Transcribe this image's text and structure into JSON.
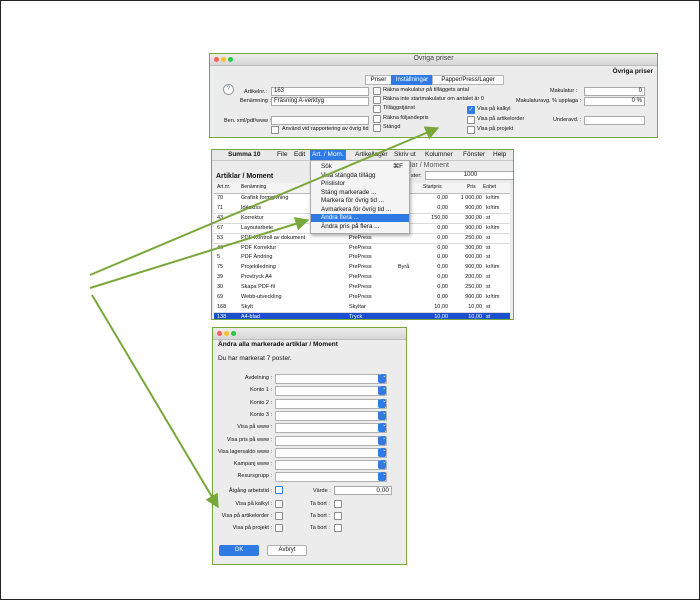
{
  "colors": {
    "accent": "#2f7ae5",
    "arrow": "#79a83a",
    "selected_row": "#1b4fcf"
  },
  "prices_window": {
    "title": "Övriga priser",
    "heading": "Övriga priser",
    "tabs": [
      "Priser",
      "Inställningar",
      "Papper/Press/Lager"
    ],
    "selected_tab": "Inställningar",
    "help_icon": "?",
    "artnr_label": "Artikelnr.:",
    "artnr_value": "163",
    "desc_label": "Benämning :",
    "desc_value": "Fräsning A-verktyg",
    "alt_label": "Ben. xml/pdf/www :",
    "alt_value": "",
    "use_stats_label": "Använd vid rapportering av övrig tid",
    "middle_checks": [
      {
        "label": "Räkna makulatur på tilläggets antal",
        "checked": false
      },
      {
        "label": "Räkna inte startmakulatur om antalet är 0",
        "checked": false
      },
      {
        "label": "Tilläggstjänst",
        "checked": false
      },
      {
        "label": "Räkna följandepris",
        "checked": false
      },
      {
        "label": "Stängd",
        "checked": false
      }
    ],
    "right_checks": [
      {
        "label": "Visa på kalkyl",
        "checked": true
      },
      {
        "label": "Visa på artikelorder",
        "checked": false
      },
      {
        "label": "Visa på projekt",
        "checked": false
      }
    ],
    "makulatur_label": "Makulatur :",
    "makulatur_value": "0",
    "makupp_label": "Makulaturavg. % upplaga :",
    "makupp_value": "0 %",
    "underavd_label": "Underavd. :",
    "underavd_value": ""
  },
  "summa_window": {
    "apple_icon": "",
    "menu": [
      "Summa 10",
      "File",
      "Edit",
      "Art. / Mom.",
      "Artikellager",
      "Skriv ut",
      "Kolumner",
      "Fönster",
      "Help"
    ],
    "selected_menu": "Art. / Mom.",
    "window_title": "Artiklar / Moment",
    "list_title": "Artiklar / Moment",
    "filter_label": "ster:",
    "filter_value": "1000",
    "columns": [
      "Art.nr.",
      "Benämning",
      "",
      "",
      "Startpris",
      "Pris",
      "Enhet"
    ],
    "rows": [
      [
        "70",
        "Grafisk formgivning",
        "",
        "",
        "0,00",
        "1 000,00",
        "kr/tim"
      ],
      [
        "71",
        "Idéskiss",
        "",
        "",
        "0,00",
        "900,00",
        "kr/tim"
      ],
      [
        "43",
        "Korrektur",
        "",
        "",
        "150,00",
        "300,00",
        "st"
      ],
      [
        "67",
        "Layoutarbete",
        "",
        "",
        "0,00",
        "900,00",
        "kr/tim"
      ],
      [
        "53",
        "PDF Kontroll av dokument",
        "PrePress",
        "",
        "0,00",
        "250,00",
        "st"
      ],
      [
        "46",
        "PDF Korrektur",
        "PrePress",
        "",
        "0,00",
        "300,00",
        "st"
      ],
      [
        "5",
        "PDF Ändring",
        "PrePress",
        "",
        "0,00",
        "600,00",
        "st"
      ],
      [
        "75",
        "Projektledning",
        "PrePress",
        "Byrå",
        "0,00",
        "900,00",
        "kr/tim"
      ],
      [
        "39",
        "Provtryck A4",
        "PrePress",
        "",
        "0,00",
        "200,00",
        "st"
      ],
      [
        "30",
        "Skapa PDF-fil",
        "PrePress",
        "",
        "0,00",
        "250,00",
        "st"
      ],
      [
        "69",
        "Webb-utveckling",
        "PrePress",
        "",
        "0,00",
        "900,00",
        "kr/tim"
      ],
      [
        "168",
        "Skylt",
        "Skyltar",
        "",
        "10,00",
        "10,00",
        "st"
      ],
      [
        "138",
        "A4-blad",
        "Tryck",
        "",
        "10,00",
        "10,00",
        "st"
      ]
    ],
    "selected_row": 12,
    "dropdown": [
      {
        "label": "Sök",
        "shortcut": "⌘F"
      },
      {
        "label": "Visa stängda tillägg",
        "shortcut": ""
      },
      {
        "label": "Prislistor",
        "shortcut": ""
      },
      {
        "label": "Stäng markerade ...",
        "shortcut": ""
      },
      {
        "label": "Markera för övrig tid ...",
        "shortcut": ""
      },
      {
        "label": "Avmarkera för övrig tid ...",
        "shortcut": ""
      },
      {
        "label": "Ändra flera ...",
        "shortcut": ""
      },
      {
        "label": "Ändra pris på flera ...",
        "shortcut": ""
      }
    ],
    "dropdown_selected": 6
  },
  "change_window": {
    "title": "Ändra alla markerade artiklar / Moment",
    "info": "Du har markerat 7 poster.",
    "selects": [
      "Avdelning :",
      "Konto 1 :",
      "Konto 2 :",
      "Konto 3 :",
      "Visa på www :",
      "Visa pris på www :",
      "Visa lagersaldo www :",
      "Kampanj www :",
      "Resursgrupp :"
    ],
    "select_arrow": "⌃⌄",
    "agang_label": "Åtgång arbetstid :",
    "value_label": "Värde :",
    "value_text": "0,00",
    "check_rows": [
      {
        "left": "Visa på kalkyl :",
        "right": "Ta bort :"
      },
      {
        "left": "Visa på artikelorder :",
        "right": "Ta bort :"
      },
      {
        "left": "Visa på projekt :",
        "right": "Ta bort :"
      }
    ],
    "ok_label": "OK",
    "cancel_label": "Avbryt"
  }
}
